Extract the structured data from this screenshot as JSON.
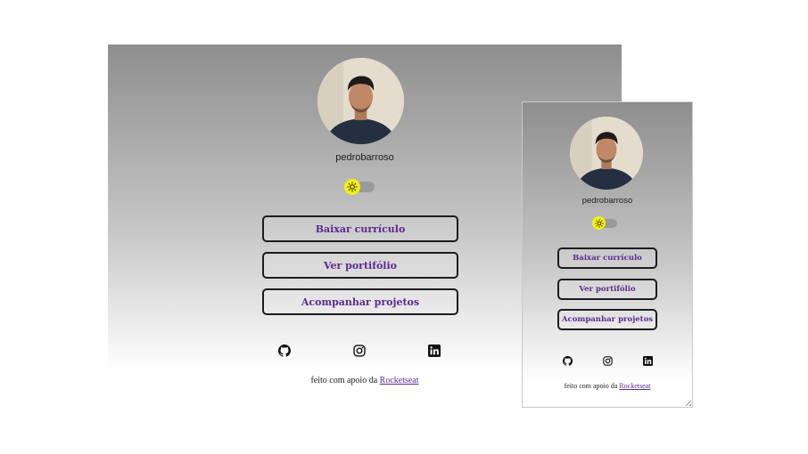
{
  "profile": {
    "username": "pedrobarroso"
  },
  "theme_toggle": {
    "icon": "sun-icon",
    "knob_color": "#f4f111"
  },
  "links": [
    {
      "label": "Baixar currículo"
    },
    {
      "label": "Ver portifólio"
    },
    {
      "label": "Acompanhar projetos"
    }
  ],
  "social": [
    {
      "icon": "github-icon"
    },
    {
      "icon": "instagram-icon"
    },
    {
      "icon": "linkedin-icon"
    }
  ],
  "footer": {
    "text": "feito com apoio da",
    "link_label": "Rocketseat"
  },
  "colors": {
    "accent": "#5a2a8e",
    "button_border": "#1c1c1c",
    "gradient_top": "#8e8e8e",
    "gradient_bottom": "#ffffff"
  }
}
